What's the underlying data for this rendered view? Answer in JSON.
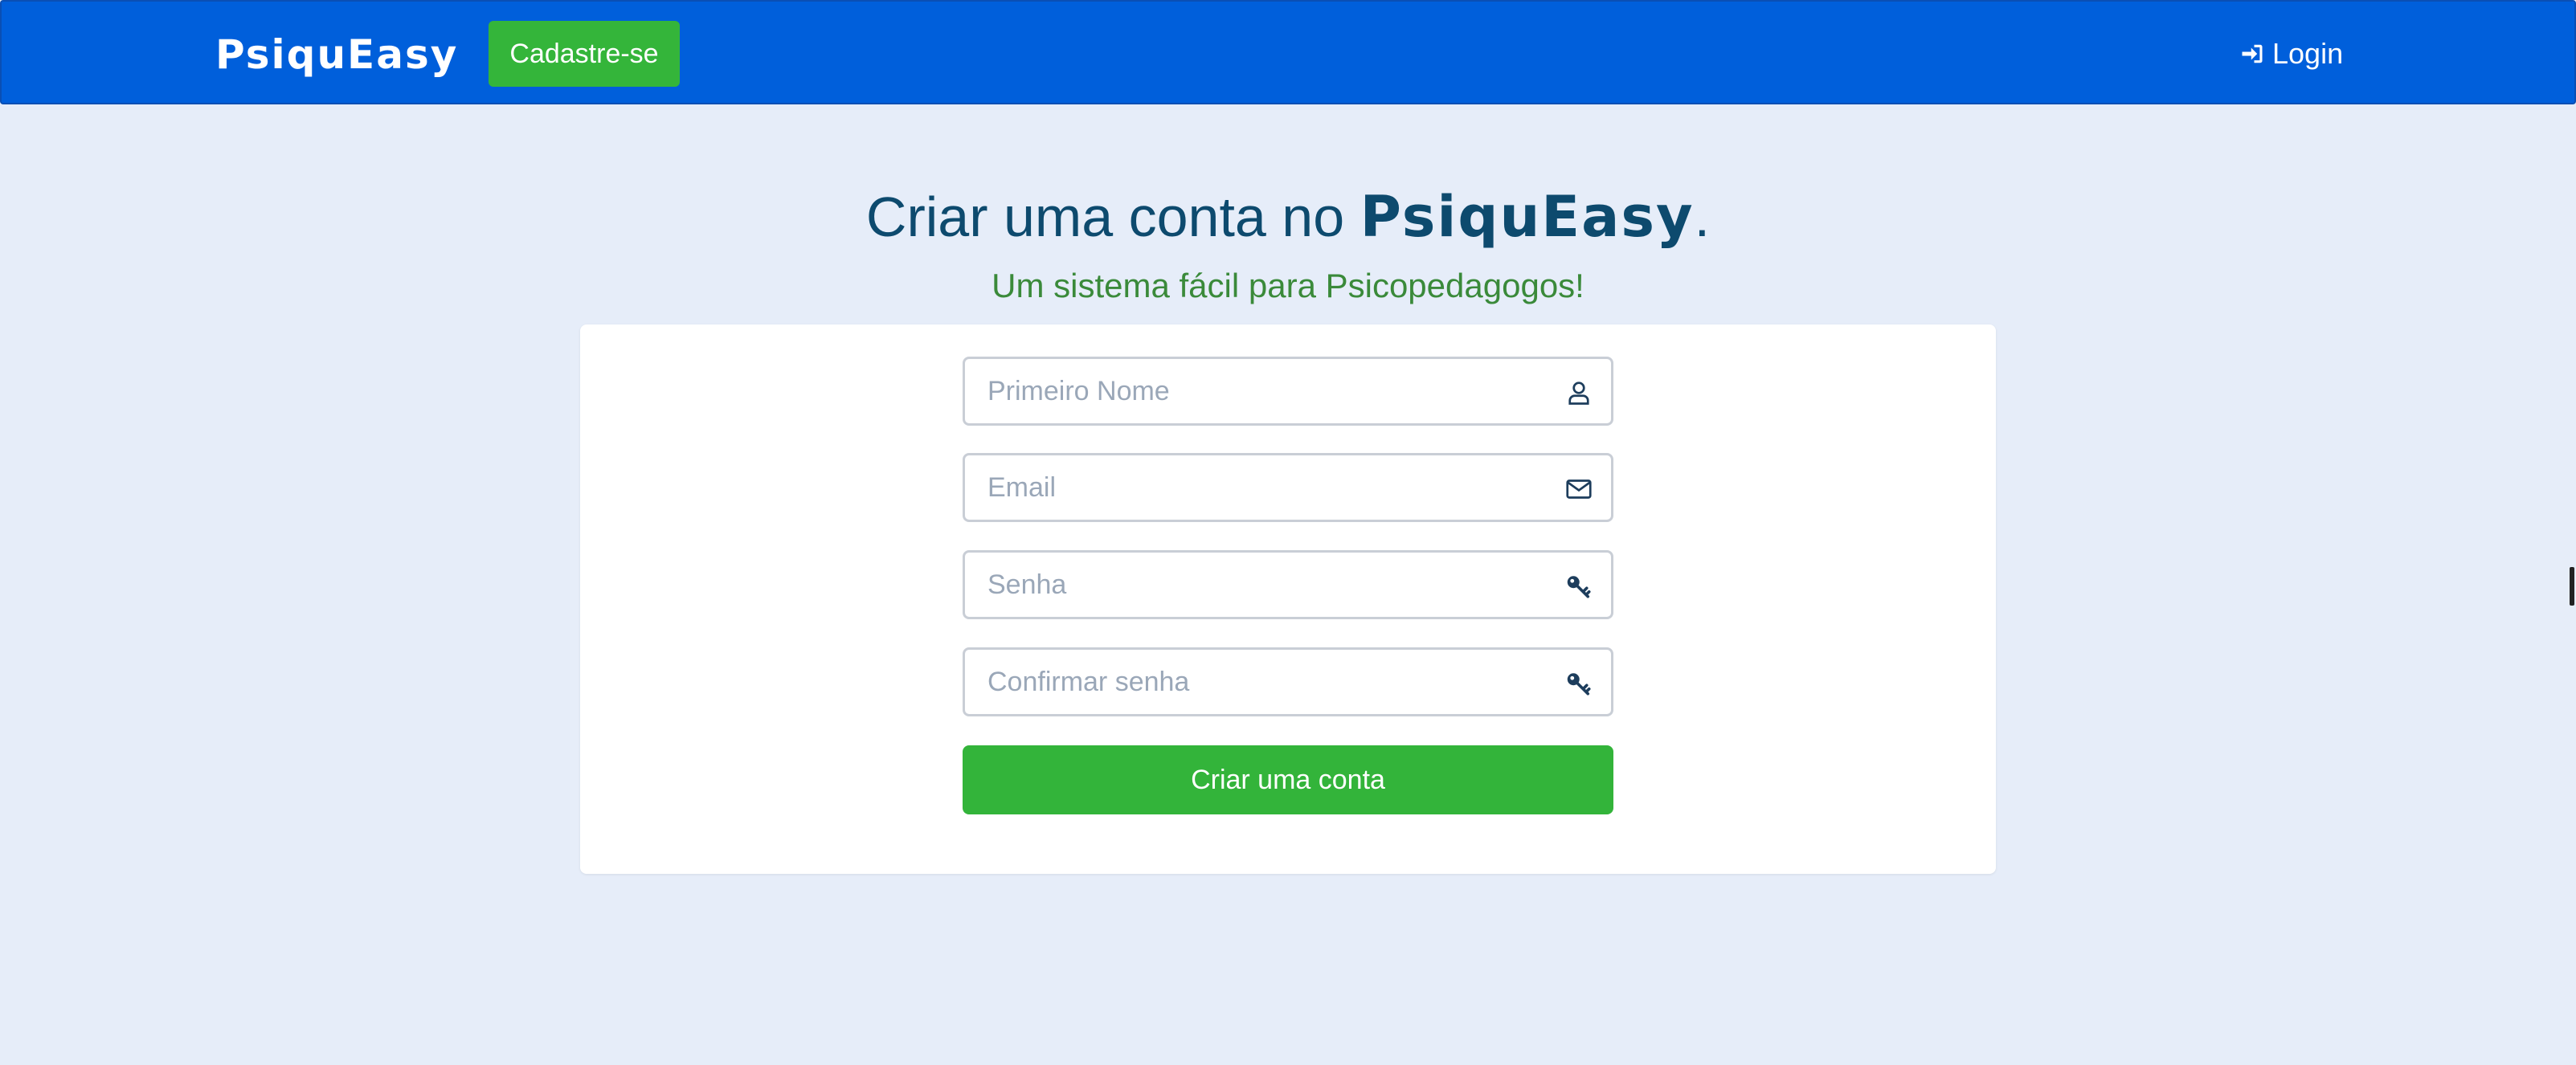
{
  "navbar": {
    "brand": "PsiquEasy",
    "signup_label": "Cadastre-se",
    "login_label": "Login",
    "login_icon": "sign-in-icon",
    "background": "#005fdb"
  },
  "hero": {
    "title_prefix": "Criar uma conta no ",
    "title_brand": "PsiquEasy",
    "title_suffix": ".",
    "subtitle": "Um sistema fácil para Psicopedagogos!"
  },
  "form": {
    "first_name": {
      "placeholder": "Primeiro Nome",
      "value": "",
      "icon": "user-icon"
    },
    "email": {
      "placeholder": "Email",
      "value": "",
      "icon": "envelope-icon"
    },
    "password": {
      "placeholder": "Senha",
      "value": "",
      "icon": "key-icon"
    },
    "confirm_password": {
      "placeholder": "Confirmar senha",
      "value": "",
      "icon": "key-icon"
    },
    "submit_label": "Criar uma conta"
  },
  "colors": {
    "accent_green": "#33b43a",
    "title_blue": "#0d4a6e",
    "subtitle_green": "#3a8a3a",
    "page_bg": "#e6edf9"
  }
}
